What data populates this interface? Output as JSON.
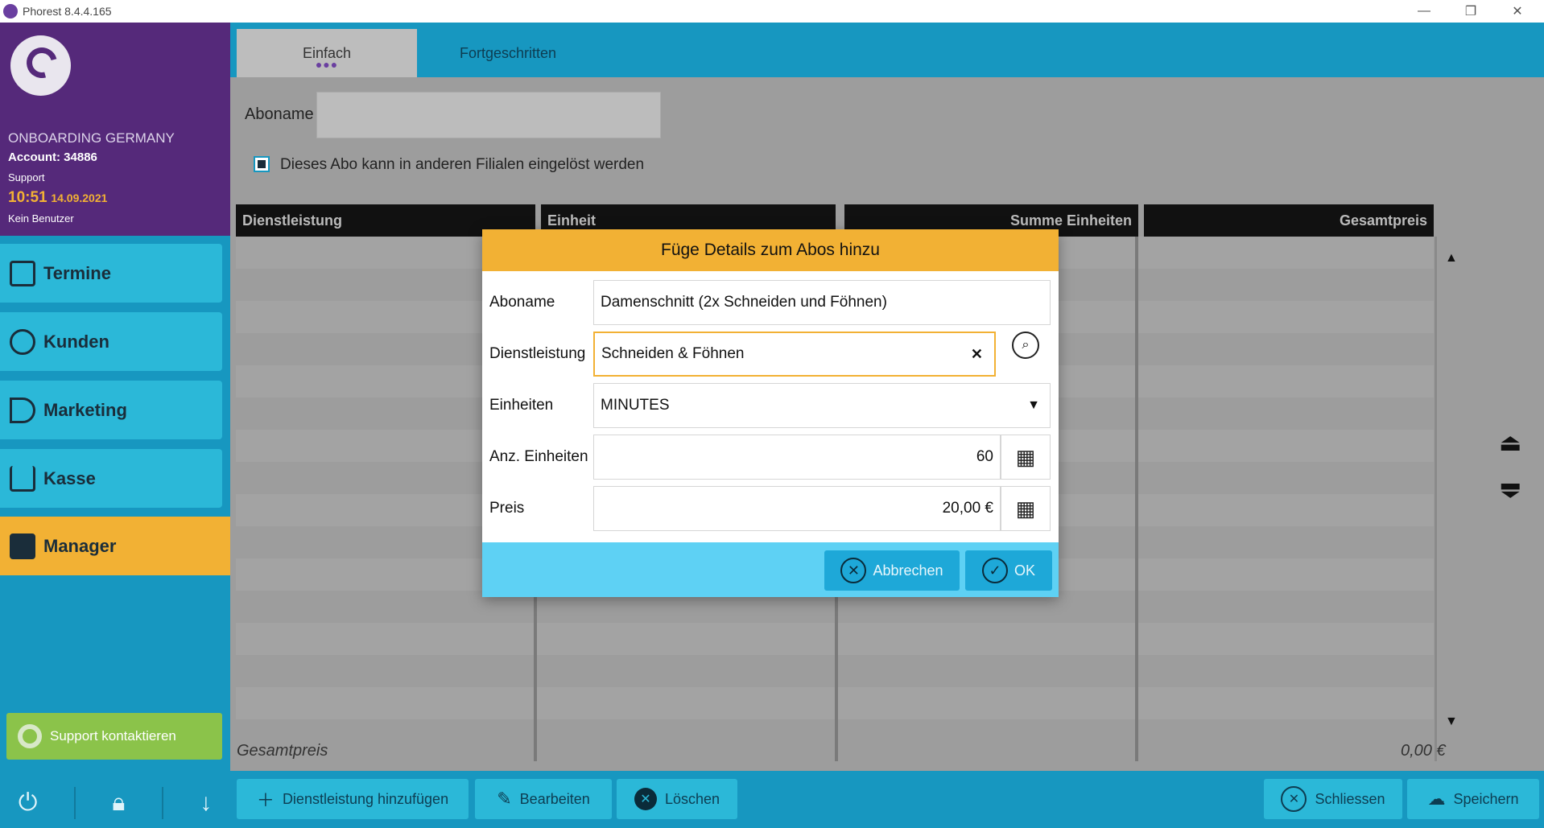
{
  "window": {
    "title": "Phorest 8.4.4.165",
    "minimize": "—",
    "maximize": "❐",
    "close": "✕"
  },
  "account": {
    "company": "ONBOARDING GERMANY",
    "account_line": "Account: 34886",
    "role": "Support",
    "time": "10:51",
    "date": "14.09.2021",
    "user": "Kein Benutzer"
  },
  "nav": {
    "items": [
      {
        "label": "Termine",
        "icon": "calendar-edit-icon"
      },
      {
        "label": "Kunden",
        "icon": "client-head-icon"
      },
      {
        "label": "Marketing",
        "icon": "megaphone-icon"
      },
      {
        "label": "Kasse",
        "icon": "shopping-cart-icon"
      },
      {
        "label": "Manager",
        "icon": "briefcase-icon"
      }
    ],
    "support_label": "Support kontaktieren"
  },
  "tabs": [
    {
      "label": "Einfach",
      "active": true
    },
    {
      "label": "Fortgeschritten",
      "active": false
    }
  ],
  "form": {
    "aboname_label": "Aboname",
    "aboname_value": "",
    "checkbox_label": "Dieses Abo kann in anderen Filialen eingelöst werden",
    "checkbox_checked": true
  },
  "table": {
    "headers": [
      "Dienstleistung",
      "Einheit",
      "Summe Einheiten",
      "Gesamtpreis"
    ],
    "rows": []
  },
  "totals": {
    "label": "Gesamtpreis",
    "value": "0,00 €"
  },
  "bottom_buttons": {
    "add": "Dienstleistung hinzufügen",
    "edit": "Bearbeiten",
    "delete": "Löschen",
    "close": "Schliessen",
    "save": "Speichern"
  },
  "dialog": {
    "title": "Füge Details zum Abos hinzu",
    "aboname_label": "Aboname",
    "aboname_value": "Damenschnitt (2x Schneiden und Föhnen)",
    "service_label": "Dienstleistung",
    "service_value": "Schneiden & Föhnen",
    "units_label": "Einheiten",
    "units_value": "MINUTES",
    "count_label": "Anz. Einheiten",
    "count_value": "60",
    "price_label": "Preis",
    "price_value": "20,00 €",
    "cancel_label": "Abbrechen",
    "ok_label": "OK"
  },
  "colors": {
    "purple": "#55297a",
    "cyan": "#1797c0",
    "nav_button": "#2bb8d8",
    "accent_orange": "#f2b134",
    "support_green": "#8bc34a",
    "dialog_footer": "#5ed1f4"
  }
}
